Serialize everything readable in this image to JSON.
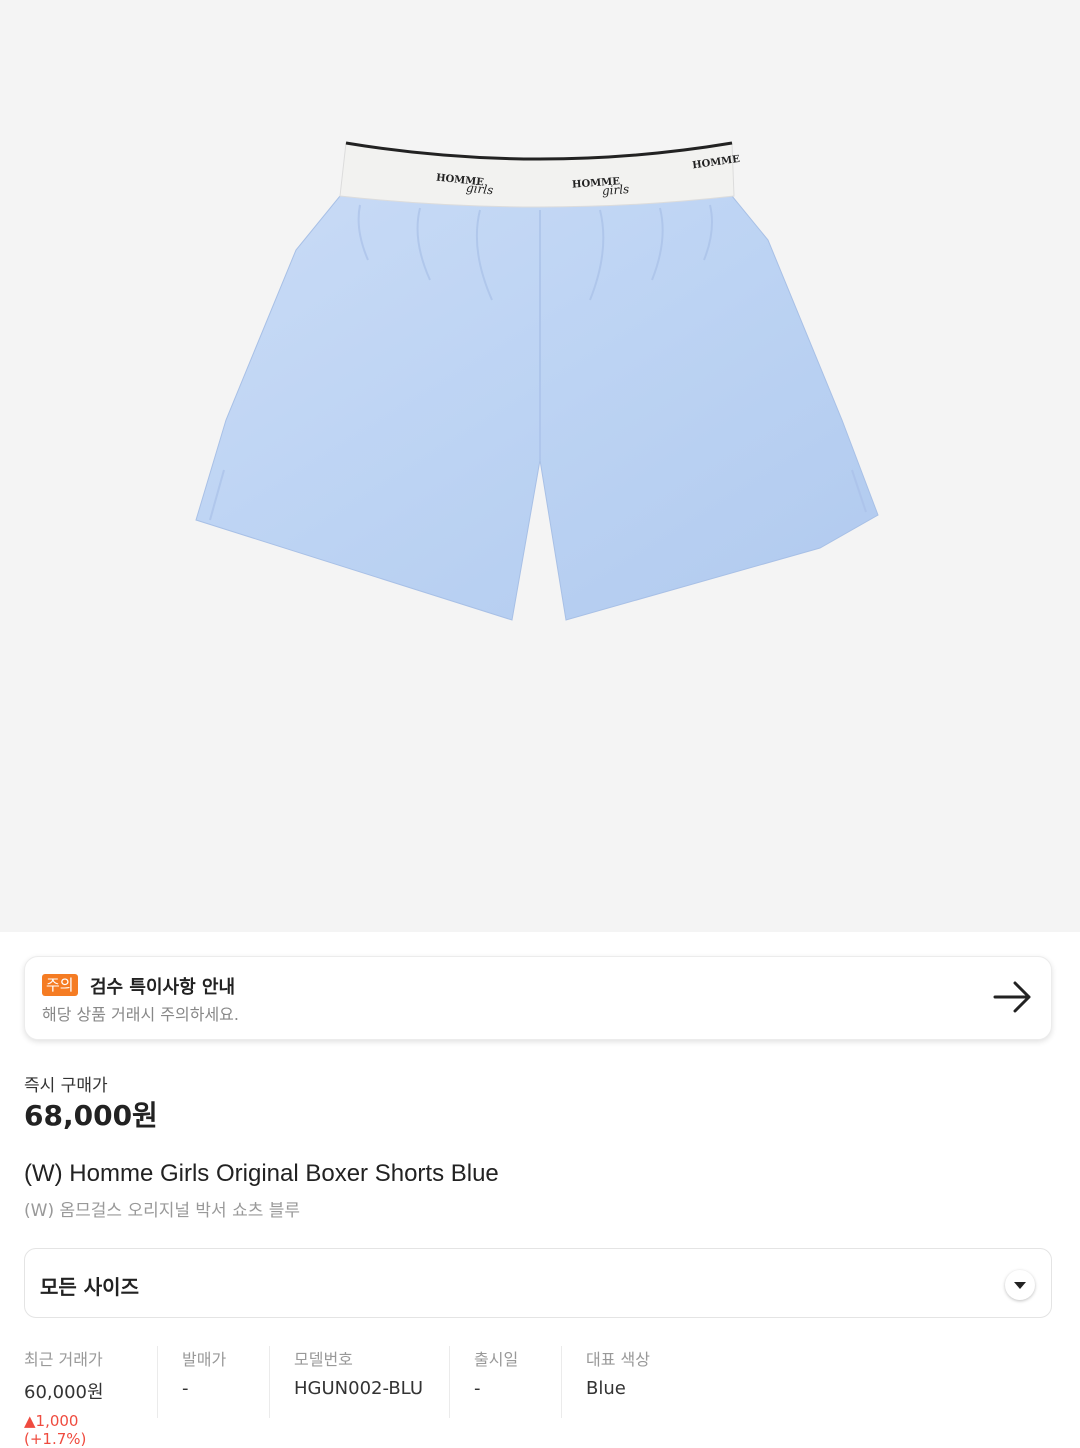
{
  "product_image": {
    "waistband_text": [
      "HOMME",
      "girls"
    ]
  },
  "notice": {
    "badge": "주의",
    "title": "검수 특이사항 안내",
    "subtitle": "해당 상품 거래시 주의하세요.",
    "icon": "arrow-right-icon"
  },
  "price": {
    "label": "즉시 구매가",
    "value": "68,000원"
  },
  "product": {
    "name_en": "(W) Homme Girls Original Boxer Shorts Blue",
    "name_ko": "(W) 옴므걸스 오리지널 박서 쇼츠 블루"
  },
  "size_select": {
    "label": "모든 사이즈",
    "icon": "chevron-down-icon"
  },
  "info": [
    {
      "key": "최근 거래가",
      "value": "60,000원",
      "delta": "▲1,000 (+1.7%)"
    },
    {
      "key": "발매가",
      "value": "-"
    },
    {
      "key": "모델번호",
      "value": "HGUN002-BLU"
    },
    {
      "key": "출시일",
      "value": "-"
    },
    {
      "key": "대표 색상",
      "value": "Blue"
    }
  ],
  "colors": {
    "accent_badge": "#f57c23",
    "price_up": "#ef4b3f",
    "hero_bg": "#f4f4f4",
    "shorts_blue": "#bcd3f3"
  }
}
